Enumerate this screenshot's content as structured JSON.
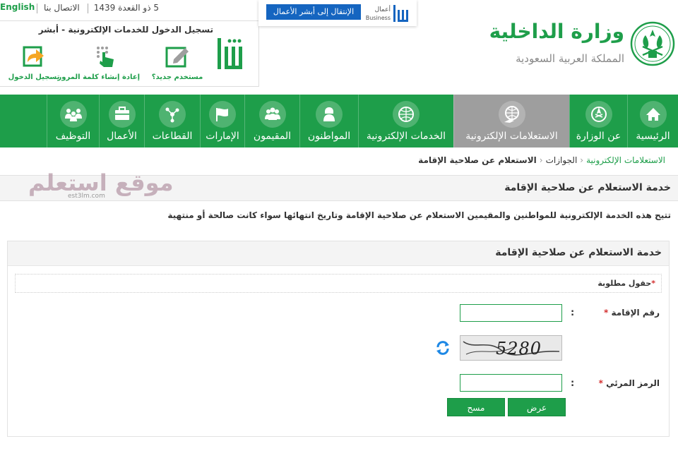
{
  "topbar": {
    "date": "5 ذو القعدة 1439",
    "contact": "الاتصال بنا",
    "language": "English"
  },
  "login": {
    "title": "تسجيل الدخول للخدمات الإلكترونية - أبشر",
    "items": [
      {
        "label": "مستخدم جديد؟",
        "icon": "edit-icon"
      },
      {
        "label": "إعادة إنشاء كلمة المرور",
        "icon": "keypad-touch-icon"
      },
      {
        "label": "تسجيل الدخول",
        "icon": "login-arrow-icon"
      }
    ]
  },
  "business": {
    "button": "الإنتقال إلى أبشر الأعمال",
    "logo_ar": "أعمال",
    "logo_en": "Business"
  },
  "ministry": {
    "title": "وزارة الداخلية",
    "subtitle": "المملكة العربية السعودية"
  },
  "nav": [
    {
      "label": "الرئيسية",
      "icon": "home-icon"
    },
    {
      "label": "عن الوزارة",
      "icon": "emblem-icon"
    },
    {
      "label": "الاستعلامات الإلكترونية",
      "icon": "globe-hand-icon",
      "active": true
    },
    {
      "label": "الخدمات الإلكترونية",
      "icon": "globe-icon"
    },
    {
      "label": "المواطنون",
      "icon": "person-icon"
    },
    {
      "label": "المقيمون",
      "icon": "people-icon"
    },
    {
      "label": "الإمارات",
      "icon": "flag-icon"
    },
    {
      "label": "القطاعات",
      "icon": "network-icon"
    },
    {
      "label": "الأعمال",
      "icon": "briefcase-icon"
    },
    {
      "label": "التوظيف",
      "icon": "team-icon"
    }
  ],
  "breadcrumb": {
    "root": "الاستعلامات الإلكترونية",
    "mid": "الجوازات",
    "current": "الاستعلام عن صلاحية الإقامة"
  },
  "watermark": {
    "text": "موقع استعلم",
    "sub": "est3lm.com"
  },
  "page": {
    "section_title": "خدمة الاستعلام عن صلاحية الإقامة",
    "description": "تتيح هذه الخدمة الإلكترونية للمواطنين والمقيمين الاستعلام عن صلاحية الإقامة وتاريخ انتهائها سواء كانت صالحة أو منتهية"
  },
  "form": {
    "title": "خدمة الاستعلام عن صلاحية الإقامة",
    "required_note": "حقول مطلوبة",
    "required_mark": "*",
    "colon": ":",
    "iqama_label": "رقم الإقامة",
    "iqama_value": "",
    "captcha_text": "5280",
    "visual_code_label": "الرمز المرئي",
    "visual_code_value": "",
    "submit_label": "عرض",
    "clear_label": "مسح"
  },
  "colors": {
    "primary": "#1e9e4a",
    "active_nav": "#9e9e9e",
    "business_button": "#1565c0"
  }
}
